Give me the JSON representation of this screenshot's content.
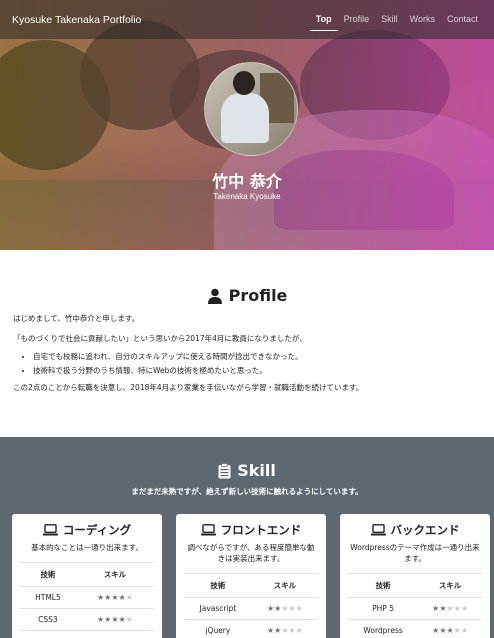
{
  "nav": {
    "brand": "Kyosuke Takenaka Portfolio",
    "links": [
      {
        "label": "Top",
        "active": true
      },
      {
        "label": "Profile",
        "active": false
      },
      {
        "label": "Skill",
        "active": false
      },
      {
        "label": "Works",
        "active": false
      },
      {
        "label": "Contact",
        "active": false
      }
    ]
  },
  "hero": {
    "name": "竹中 恭介",
    "name_en": "Takenaka Kyosuke"
  },
  "profile": {
    "title": "Profile",
    "icon": "user-icon",
    "p1": "はじめまして、竹中恭介と申します。",
    "p2": "「ものづくりで社会に貢献したい」という思いから2017年4月に教員になりましたが、",
    "bullets": [
      "自宅でも校務に追われ、自分のスキルアップに使える時間が捻出できなかった。",
      "技術科で扱う分野のうち情報、特にWebの技術を極めたいと思った。"
    ],
    "p3": "この2点のことから転職を決意し、2018年4月より家業を手伝いながら学習・就職活動を続けています。"
  },
  "skill": {
    "title": "Skill",
    "icon": "clipboard-icon",
    "subtitle": "まだまだ未熟ですが、絶えず新しい技術に触れるようにしています。",
    "header_tech": "技術",
    "header_skill": "スキル",
    "cards": [
      {
        "title": "コーディング",
        "icon": "laptop-icon",
        "desc": "基本的なことは一通り出来ます。",
        "rows": [
          {
            "tech": "HTML5",
            "stars": 4
          },
          {
            "tech": "CSS3",
            "stars": 4
          }
        ]
      },
      {
        "title": "フロントエンド",
        "icon": "laptop-icon",
        "desc": "調べながらですが、ある程度簡単な動きは実装出来ます。",
        "rows": [
          {
            "tech": "Javascript",
            "stars": 2
          },
          {
            "tech": "jQuery",
            "stars": 2
          }
        ]
      },
      {
        "title": "バックエンド",
        "icon": "laptop-icon",
        "desc": "Wordpressのテーマ作成は一通り出来ます。",
        "rows": [
          {
            "tech": "PHP 5",
            "stars": 2
          },
          {
            "tech": "Wordpress",
            "stars": 3
          }
        ]
      }
    ]
  }
}
